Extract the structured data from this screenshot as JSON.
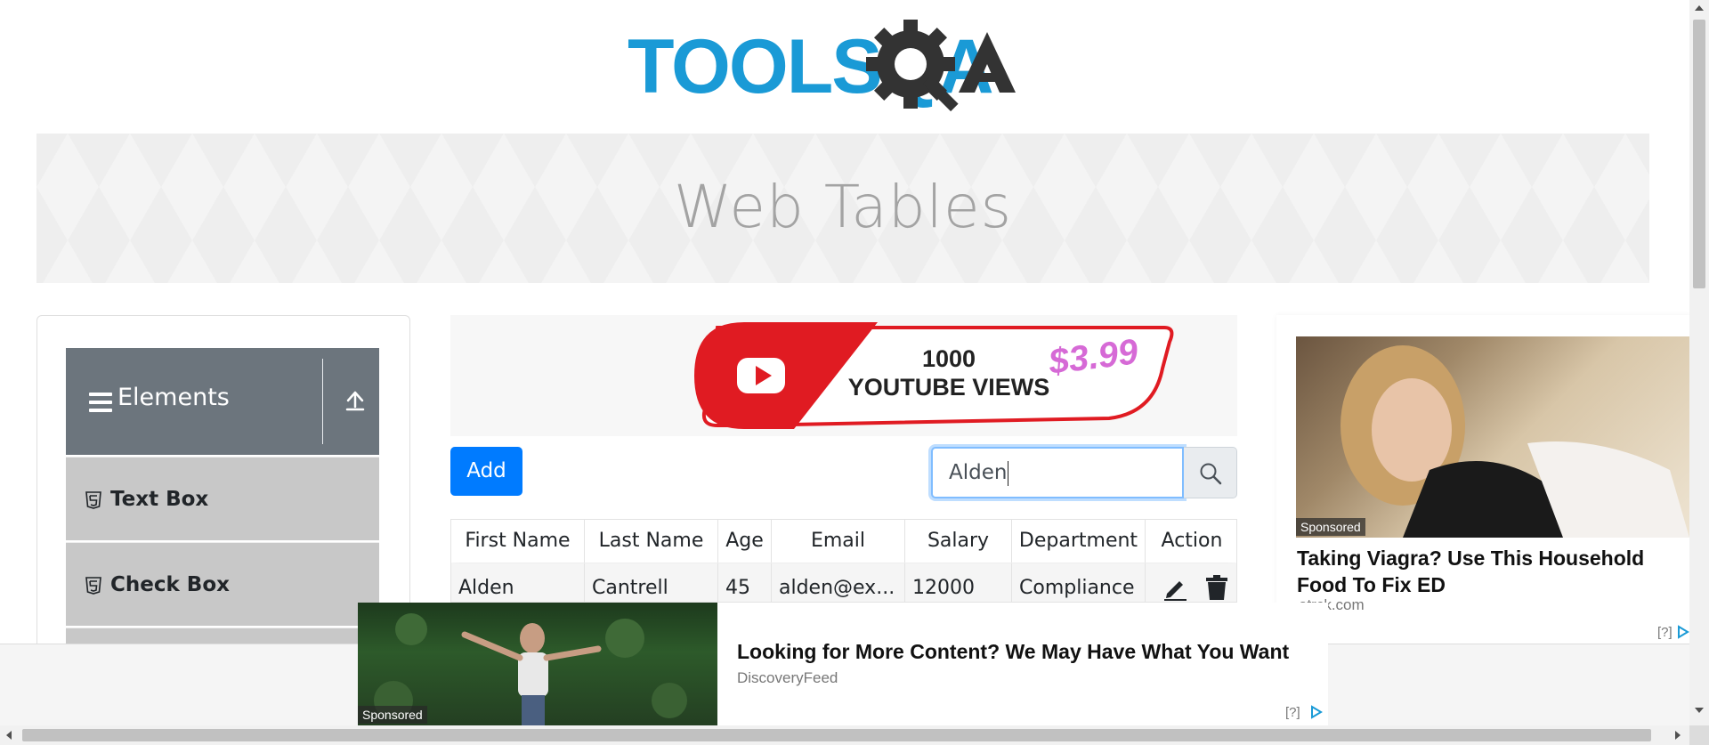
{
  "logo": {
    "text": "TOOLSQA",
    "colors": {
      "tools": "#1a9ad6",
      "qa": "#333333"
    }
  },
  "banner": {
    "title": "Web Tables"
  },
  "sidebar": {
    "group": {
      "title": "Elements",
      "menu_icon": "hamburger-icon",
      "collapse_icon": "upload-arrow-icon"
    },
    "items": [
      {
        "label": "Text Box",
        "icon": "html5-icon"
      },
      {
        "label": "Check Box",
        "icon": "html5-icon"
      }
    ]
  },
  "ad_top": {
    "line1": "1000",
    "line2": "YOUTUBE VIEWS",
    "price": "$3.99"
  },
  "toolbar": {
    "add_label": "Add"
  },
  "search": {
    "value": "Alden",
    "icon": "search-icon"
  },
  "table": {
    "headers": [
      "First Name",
      "Last Name",
      "Age",
      "Email",
      "Salary",
      "Department",
      "Action"
    ],
    "rows": [
      {
        "first": "Alden",
        "last": "Cantrell",
        "age": "45",
        "email": "alden@ex...",
        "salary": "12000",
        "department": "Compliance"
      }
    ]
  },
  "ad_right": {
    "sponsored": "Sponsored",
    "title": "Taking Viagra? Use This Household Food To Fix ED",
    "source": "otrck.com",
    "marker": "[?]"
  },
  "ad_bottom": {
    "sponsored": "Sponsored",
    "title": "Looking for More Content? We May Have What You Want",
    "source": "DiscoveryFeed",
    "marker": "[?]"
  },
  "colors": {
    "primary": "#007bff",
    "group_header": "#6c757d",
    "menu_item": "#c8c8c8",
    "youtube_red": "#e01b22"
  }
}
